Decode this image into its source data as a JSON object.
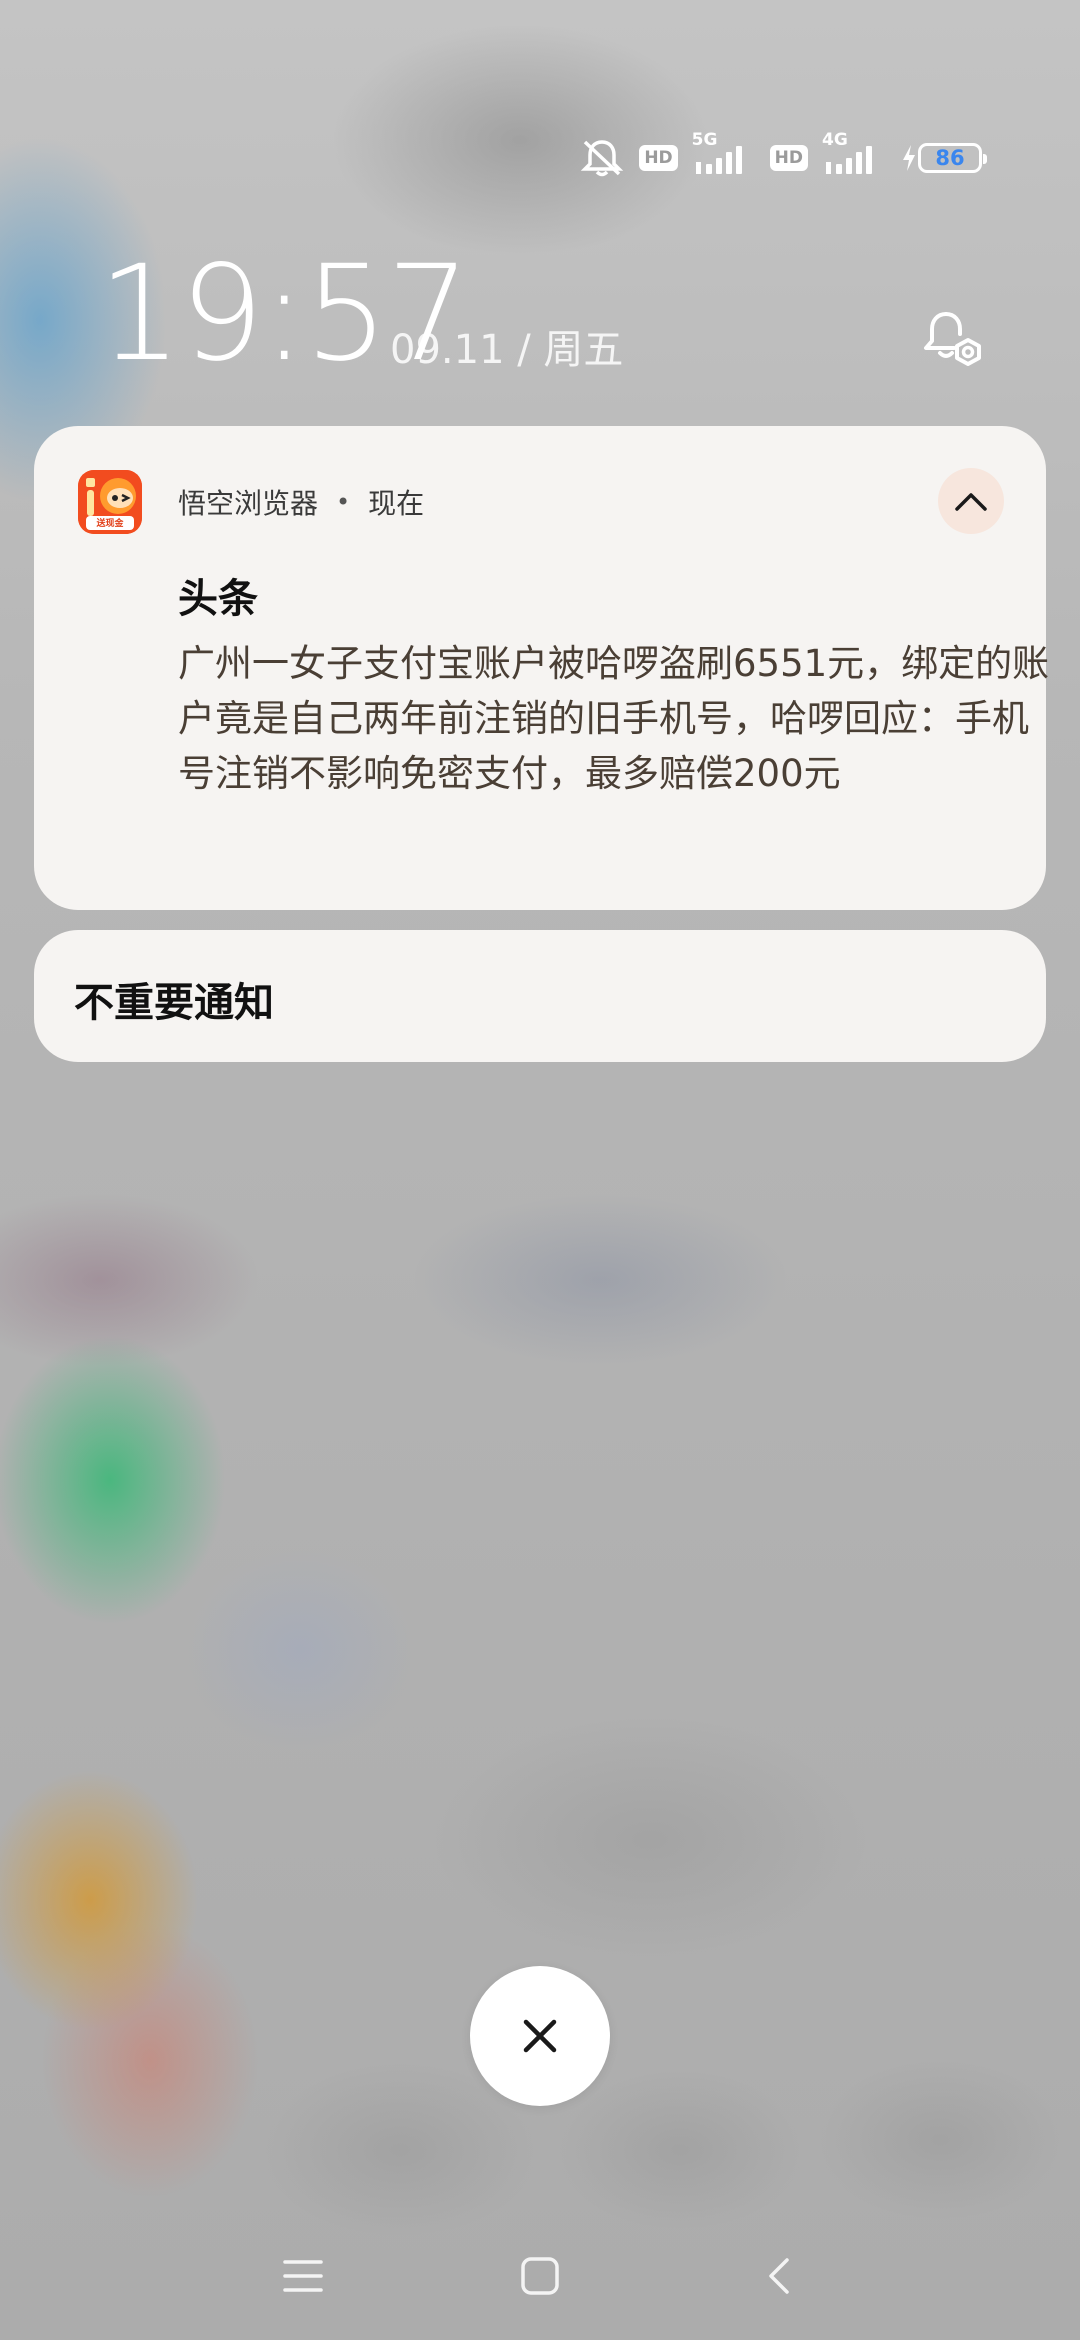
{
  "status_bar": {
    "sim1_badge": "HD",
    "sim1_network": "5G",
    "sim2_badge": "HD",
    "sim2_network": "4G",
    "battery_level": "86",
    "icons": [
      "mute-icon",
      "signal-icon",
      "battery-charging-icon"
    ]
  },
  "lock_screen": {
    "time": "19:57",
    "date": "09.11 / 周五"
  },
  "notification": {
    "app_name": "悟空浏览器",
    "separator": "•",
    "timestamp": "现在",
    "title": "头条",
    "body": "广州一女子支付宝账户被哈啰盗刷6551元，绑定的账户竟是自己两年前注销的旧手机号，哈啰回应：手机号注销不影响免密支付，最多赔偿200元",
    "app_icon_caption": "送现金"
  },
  "low_priority": {
    "label": "不重要通知"
  },
  "colors": {
    "card_bg": "#f6f4f2",
    "collapse_bg": "#f7e6dd",
    "battery_text": "#3a86ee",
    "app_icon": "#f04a20"
  }
}
